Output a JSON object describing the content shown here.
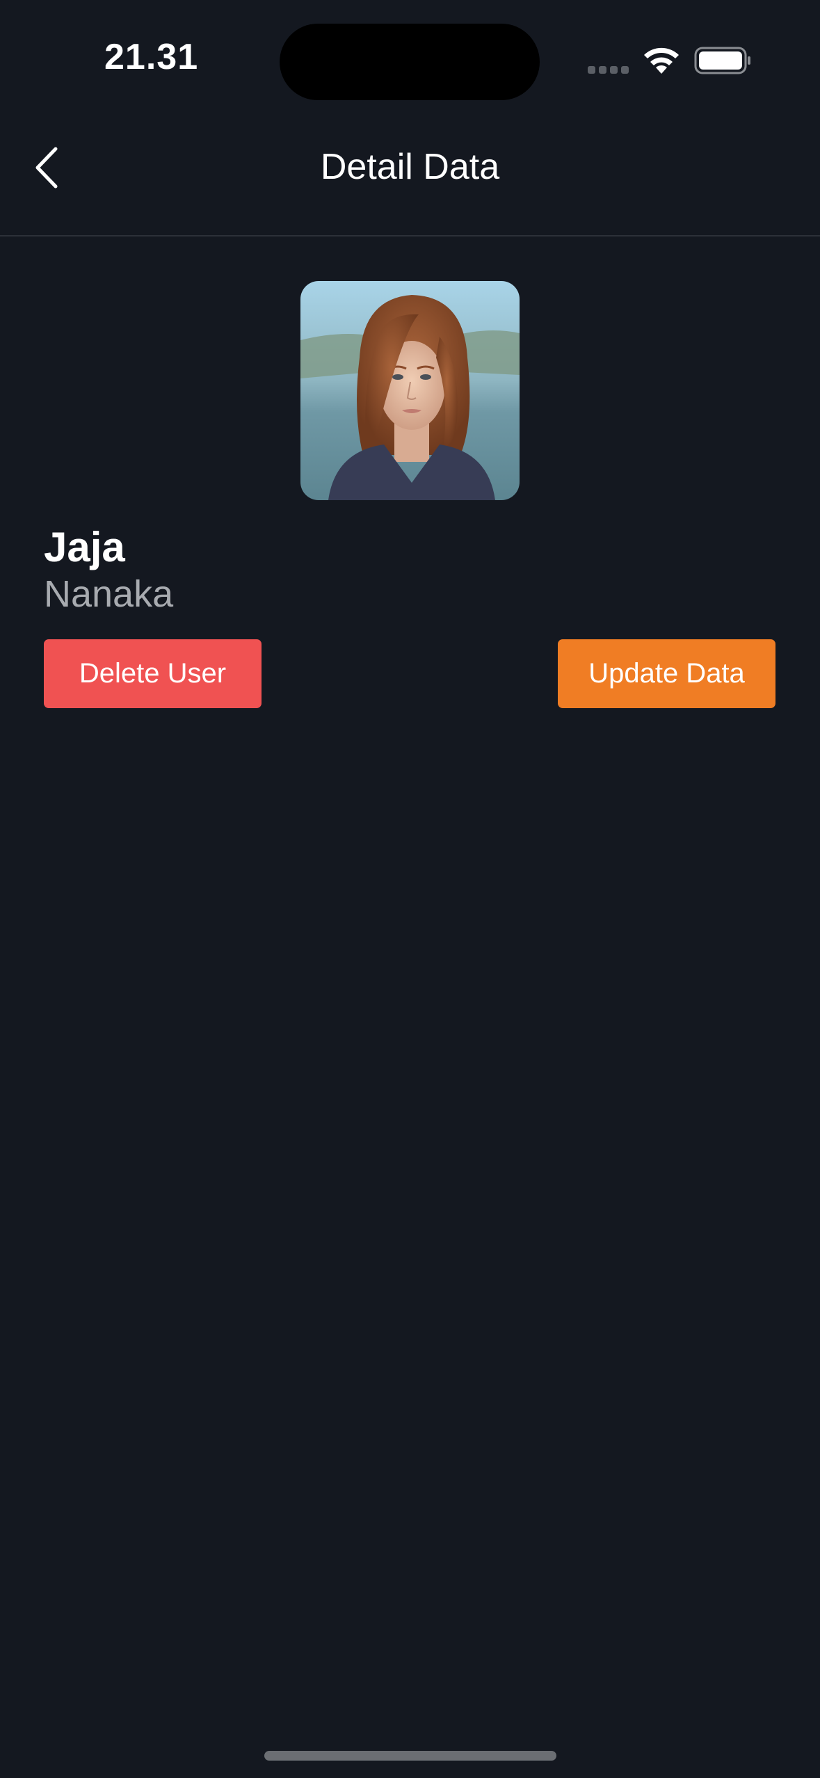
{
  "status_bar": {
    "time": "21.31",
    "icons": [
      "signal-dots-icon",
      "wifi-icon",
      "battery-icon"
    ]
  },
  "nav": {
    "title": "Detail Data",
    "back_icon": "chevron-left-icon"
  },
  "user": {
    "first_name": "Jaja",
    "last_name": "Nanaka",
    "avatar_alt": "avatar"
  },
  "actions": {
    "delete_label": "Delete User",
    "update_label": "Update Data"
  },
  "colors": {
    "background": "#141820",
    "delete": "#f05252",
    "update": "#f07d24",
    "secondary_text": "#a8abb0"
  }
}
